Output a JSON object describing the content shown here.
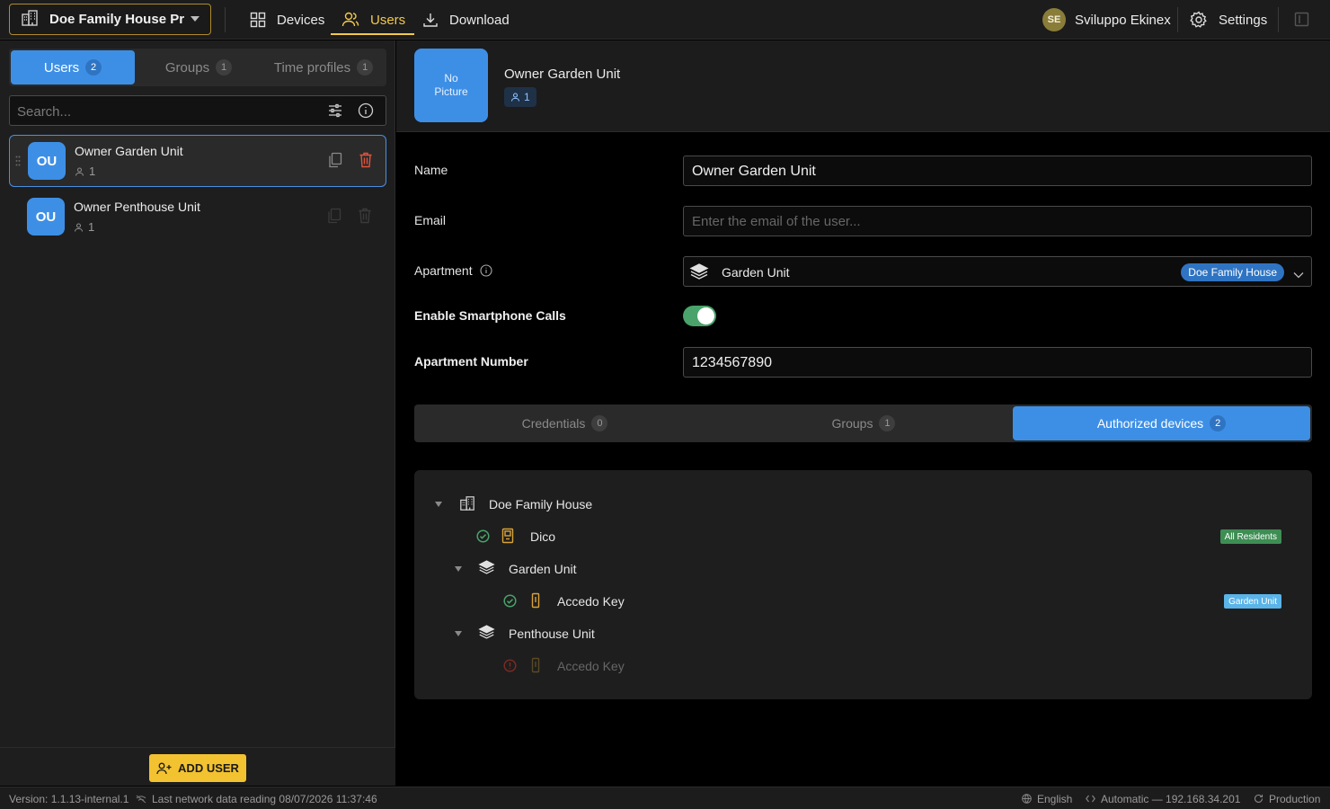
{
  "topbar": {
    "project": "Doe Family House Pro...",
    "nav": {
      "devices": "Devices",
      "users": "Users",
      "download": "Download"
    },
    "user_initials": "SE",
    "user_name": "Sviluppo Ekinex",
    "settings": "Settings"
  },
  "left": {
    "tabs": [
      {
        "label": "Users",
        "count": "2"
      },
      {
        "label": "Groups",
        "count": "1"
      },
      {
        "label": "Time profiles",
        "count": "1"
      }
    ],
    "search_placeholder": "Search...",
    "users": [
      {
        "initials": "OU",
        "name": "Owner Garden Unit",
        "count": "1"
      },
      {
        "initials": "OU",
        "name": "Owner Penthouse Unit",
        "count": "1"
      }
    ],
    "add_user": "ADD USER"
  },
  "detail": {
    "no_picture_line1": "No",
    "no_picture_line2": "Picture",
    "name": "Owner Garden Unit",
    "count": "1",
    "fields": {
      "name_label": "Name",
      "name_value": "Owner Garden Unit",
      "email_label": "Email",
      "email_placeholder": "Enter the email of the user...",
      "apartment_label": "Apartment",
      "apartment_value": "Garden Unit",
      "apartment_badge": "Doe Family House",
      "smartphone_label": "Enable Smartphone Calls",
      "smartphone_enabled": true,
      "apt_number_label": "Apartment Number",
      "apt_number_value": "1234567890"
    },
    "tabs": [
      {
        "label": "Credentials",
        "count": "0"
      },
      {
        "label": "Groups",
        "count": "1"
      },
      {
        "label": "Authorized devices",
        "count": "2"
      }
    ],
    "tree": {
      "root": "Doe Family House",
      "root_device": "Dico",
      "root_device_tag": "All Residents",
      "unit1": "Garden Unit",
      "unit1_device": "Accedo Key",
      "unit1_device_tag": "Garden Unit",
      "unit2": "Penthouse Unit",
      "unit2_device": "Accedo Key"
    }
  },
  "status": {
    "version": "Version: 1.1.13-internal.1",
    "last_reading": "Last network data reading 08/07/2026 11:37:46",
    "language": "English",
    "network": "Automatic — 192.168.34.201",
    "env": "Production"
  },
  "colors": {
    "accent": "#3d8fe6",
    "active_nav": "#f2c94c",
    "add_button": "#f2c230",
    "toggle_on": "#4aa36a"
  }
}
